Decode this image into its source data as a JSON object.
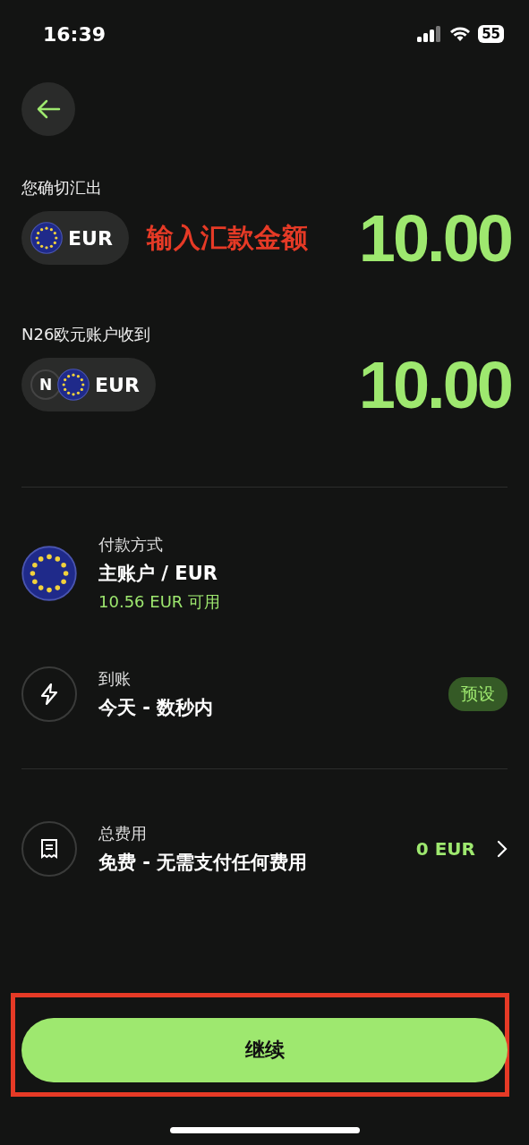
{
  "status_bar": {
    "time": "16:39",
    "battery": "55"
  },
  "send": {
    "label": "您确切汇出",
    "currency": "EUR",
    "annotation": "输入汇款金额",
    "amount": "10.00"
  },
  "receive": {
    "label": "N26欧元账户收到",
    "bank_initial": "N",
    "currency": "EUR",
    "amount": "10.00"
  },
  "details": [
    {
      "kind": "flag",
      "label": "付款方式",
      "title": "主账户 / EUR",
      "subtitle": "10.56 EUR 可用"
    },
    {
      "kind": "bolt",
      "label": "到账",
      "title": "今天 - 数秒内",
      "badge": "预设"
    },
    {
      "kind": "receipt",
      "label": "总费用",
      "title": "免费 - 无需支付任何费用",
      "value": "0 EUR",
      "chevron": true
    }
  ],
  "continue_button": {
    "label": "继续",
    "highlighted": true
  }
}
